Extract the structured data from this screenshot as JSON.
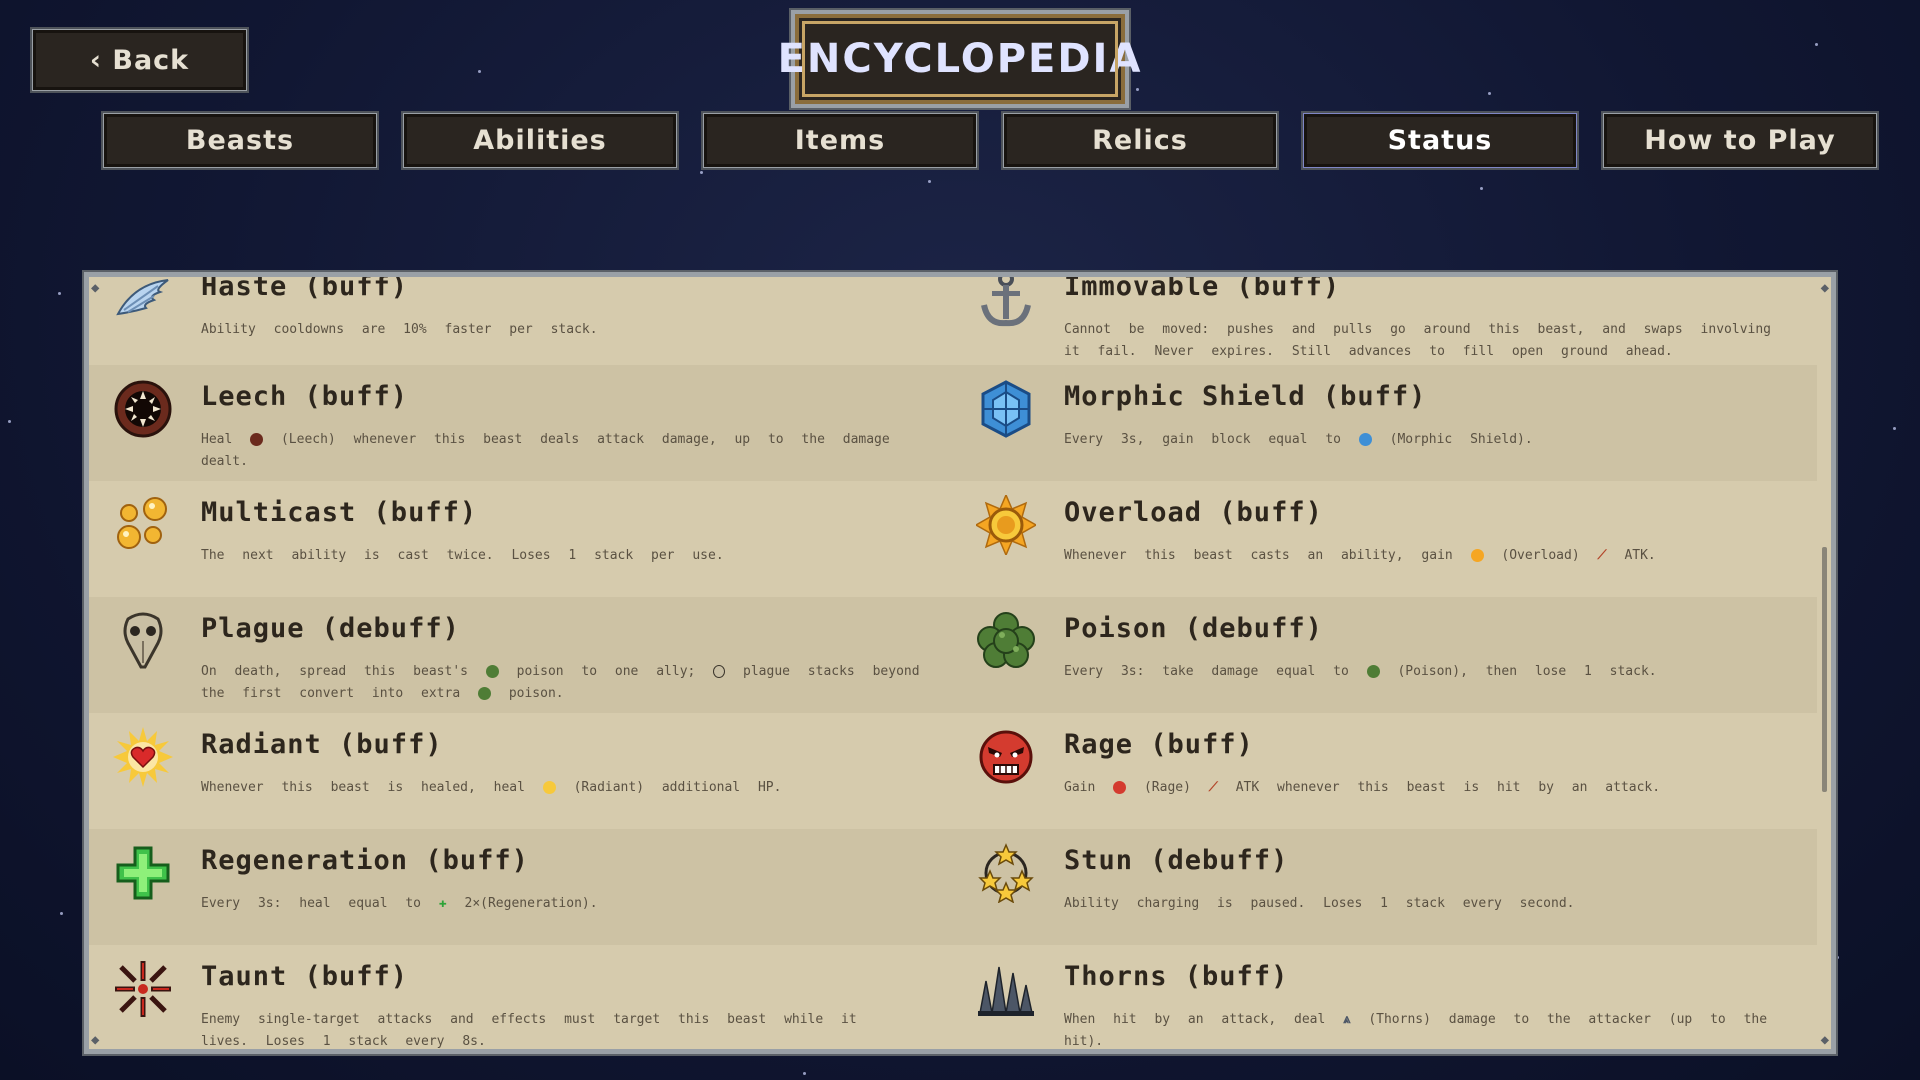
{
  "header": {
    "back_label": "‹ Back",
    "title": "ENCYCLOPEDIA"
  },
  "tabs": [
    {
      "label": "Beasts",
      "active": false
    },
    {
      "label": "Abilities",
      "active": false
    },
    {
      "label": "Items",
      "active": false
    },
    {
      "label": "Relics",
      "active": false
    },
    {
      "label": "Status",
      "active": true
    },
    {
      "label": "How to Play",
      "active": false
    }
  ],
  "statuses": {
    "haste": {
      "name": "Haste (buff)",
      "desc": "Ability cooldowns are 10% faster per stack.",
      "icon": "wing-icon"
    },
    "immovable": {
      "name": "Immovable (buff)",
      "desc": "Cannot be moved: pushes and pulls go around this beast, and swaps involving it fail. Never expires. Still advances to fill open ground ahead.",
      "icon": "anchor-icon"
    },
    "leech": {
      "name": "Leech (buff)",
      "desc_a": "Heal",
      "desc_b": "(Leech) whenever this beast deals attack damage, up to the damage dealt.",
      "icon": "fanged-maw-icon"
    },
    "morphic_shield": {
      "name": "Morphic Shield (buff)",
      "desc_a": "Every 3s, gain block equal to",
      "desc_b": "(Morphic Shield).",
      "icon": "crystal-shield-icon"
    },
    "multicast": {
      "name": "Multicast (buff)",
      "desc": "The next ability is cast twice. Loses 1 stack per use.",
      "icon": "orbs-icon"
    },
    "overload": {
      "name": "Overload (buff)",
      "desc_a": "Whenever this beast casts an ability, gain",
      "desc_b": "(Overload)",
      "desc_c": "ATK.",
      "icon": "sun-orb-icon"
    },
    "plague": {
      "name": "Plague (debuff)",
      "desc_a": "On death, spread this beast's",
      "desc_b": "poison to one ally;",
      "desc_c": "plague stacks beyond the first convert into extra",
      "desc_d": "poison.",
      "icon": "plague-mask-icon"
    },
    "poison": {
      "name": "Poison (debuff)",
      "desc_a": "Every 3s: take damage equal to",
      "desc_b": "(Poison), then lose 1 stack.",
      "icon": "poison-cloud-icon"
    },
    "radiant": {
      "name": "Radiant (buff)",
      "desc_a": "Whenever this beast is healed, heal",
      "desc_b": "(Radiant) additional HP.",
      "icon": "radiant-heart-icon"
    },
    "rage": {
      "name": "Rage (buff)",
      "desc_a": "Gain",
      "desc_b": "(Rage)",
      "desc_c": "ATK whenever this beast is hit by an attack.",
      "icon": "angry-face-icon"
    },
    "regeneration": {
      "name": "Regeneration (buff)",
      "desc_a": "Every 3s: heal equal to",
      "desc_b": "2×(Regeneration).",
      "icon": "green-cross-icon"
    },
    "stun": {
      "name": "Stun (debuff)",
      "desc": "Ability charging is paused. Loses 1 stack every second.",
      "icon": "star-ring-icon"
    },
    "taunt": {
      "name": "Taunt (buff)",
      "desc": "Enemy single-target attacks and effects must target this beast while it lives. Loses 1 stack every 8s.",
      "icon": "burst-icon"
    },
    "thorns": {
      "name": "Thorns (buff)",
      "desc_a": "When hit by an attack, deal",
      "desc_b": "(Thorns) damage to the attacker (up to the hit).",
      "icon": "spikes-icon"
    }
  }
}
